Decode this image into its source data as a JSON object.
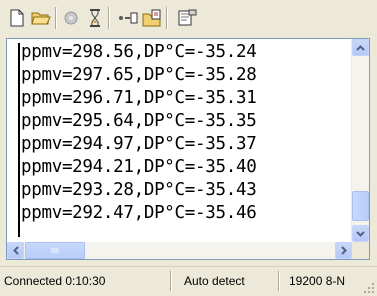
{
  "toolbar": {
    "buttons": [
      {
        "name": "new-file-icon"
      },
      {
        "name": "open-folder-icon"
      },
      {
        "name": "disconnect-icon"
      },
      {
        "name": "connect-icon"
      },
      {
        "name": "send-icon"
      },
      {
        "name": "capture-icon"
      },
      {
        "name": "properties-icon"
      }
    ]
  },
  "terminal": {
    "lines": [
      "ppmv=298.56,DP°C=-35.24",
      "ppmv=297.65,DP°C=-35.28",
      "ppmv=296.71,DP°C=-35.31",
      "ppmv=295.64,DP°C=-35.35",
      "ppmv=294.97,DP°C=-35.37",
      "ppmv=294.21,DP°C=-35.40",
      "ppmv=293.28,DP°C=-35.43",
      "ppmv=292.47,DP°C=-35.46"
    ]
  },
  "status": {
    "connection": "Connected 0:10:30",
    "detect": "Auto detect",
    "port": "19200 8-N"
  },
  "colors": {
    "window": "#ece9d8",
    "terminal_bg": "#ffffff",
    "scroll_accent": "#b9cdf9",
    "arrow": "#4d6185"
  }
}
